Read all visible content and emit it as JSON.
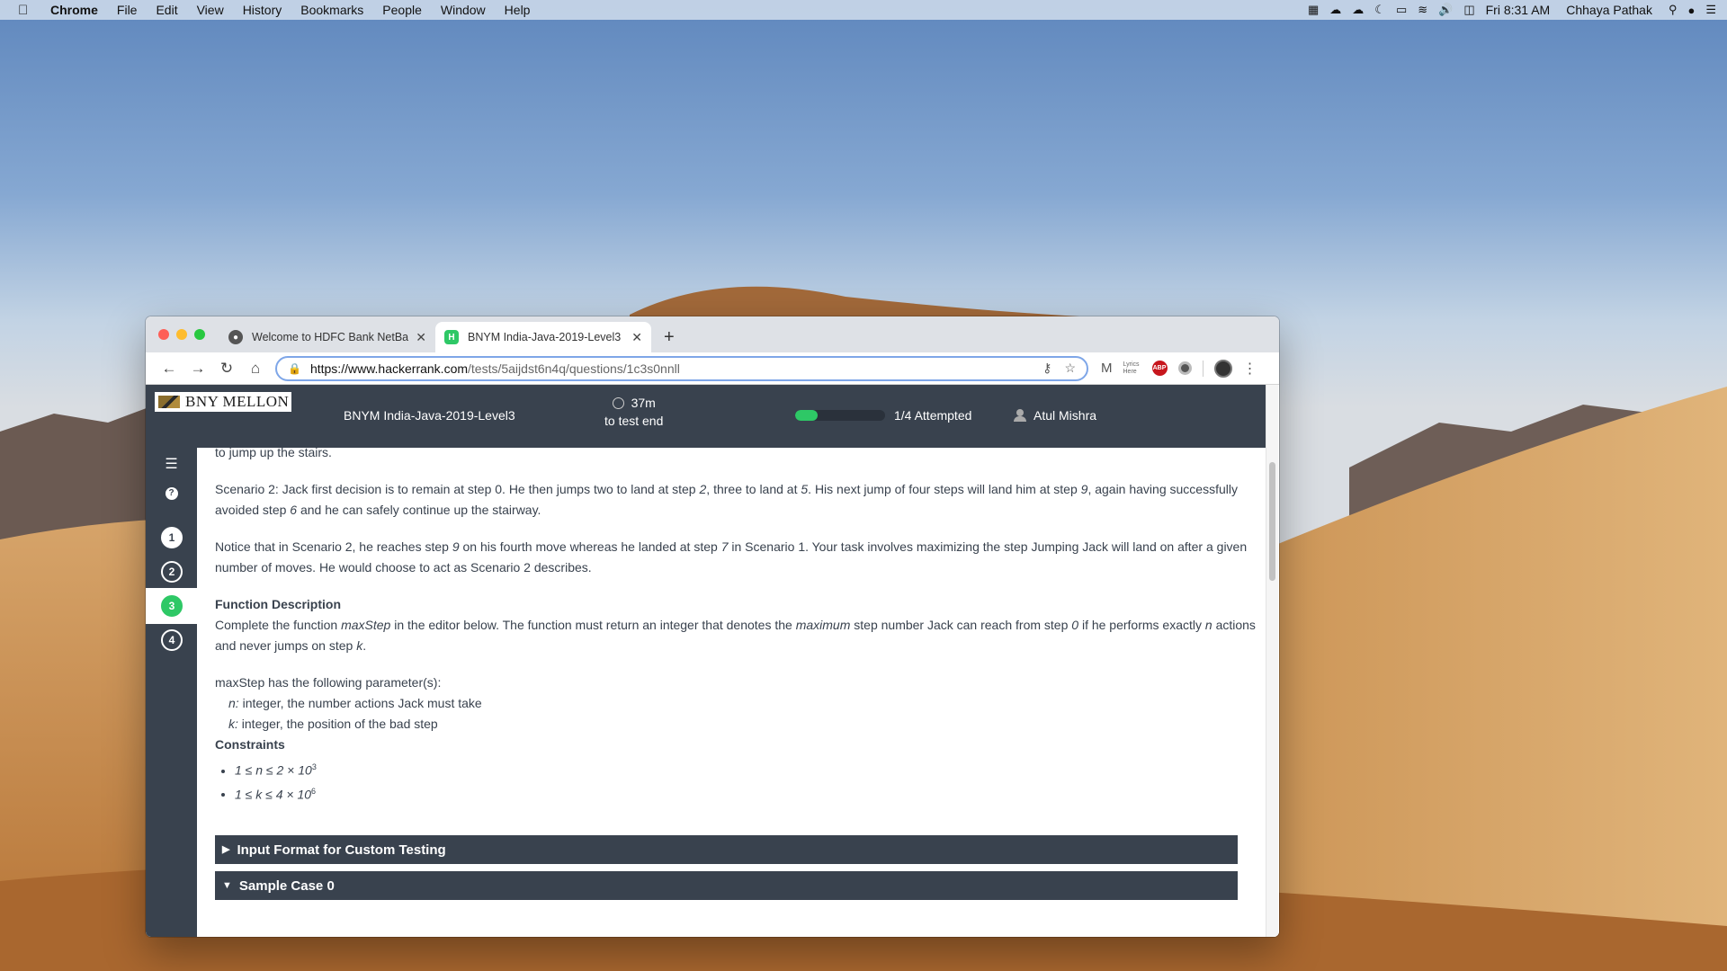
{
  "menubar": {
    "app": "Chrome",
    "menus": [
      "File",
      "Edit",
      "View",
      "History",
      "Bookmarks",
      "People",
      "Window",
      "Help"
    ],
    "clock": "Fri 8:31 AM",
    "user": "Chhaya Pathak"
  },
  "browser": {
    "tabs": [
      {
        "title": "Welcome to HDFC Bank NetBa"
      },
      {
        "title": "BNYM India-Java-2019-Level3"
      }
    ],
    "url_domain": "https://www.hackerrank.com",
    "url_path": "/tests/5aijdst6n4q/questions/1c3s0nnll",
    "extension_text": "Lyrics Here",
    "extension_abp": "ABP"
  },
  "header": {
    "logo": "BNY MELLON",
    "test_name": "BNYM India-Java-2019-Level3",
    "timer": "37m",
    "timer_sub": "to test end",
    "progress_fraction": 0.25,
    "progress_label": "1/4 Attempted",
    "user": "Atul Mishra"
  },
  "sidebar": {
    "questions": [
      "1",
      "2",
      "3",
      "4"
    ],
    "active_question": "3",
    "attempted_question": "1"
  },
  "content": {
    "line0": "to jump up the stairs.",
    "scenario2_a": "Scenario 2:  Jack first decision is to remain at step 0.  He then jumps two to land at step ",
    "scenario2_i1": "2",
    "scenario2_b": ", three to land at ",
    "scenario2_i2": "5",
    "scenario2_c": ".  His next jump of four steps will land him at step ",
    "scenario2_i3": "9",
    "scenario2_d": ", again having successfully avoided step ",
    "scenario2_i4": "6",
    "scenario2_e": " and he can safely continue up the stairway.",
    "notice_a": "Notice that in Scenario 2, he reaches step ",
    "notice_i1": "9",
    "notice_b": " on his fourth move whereas he landed at step ",
    "notice_i2": "7",
    "notice_c": " in Scenario 1. Your task involves maximizing the step Jumping Jack will land on after a given number of moves. He would choose to act as Scenario 2 describes.",
    "func_heading": "Function Description",
    "func_a": "Complete the function ",
    "func_i1": "maxStep",
    "func_b": " in the editor below. The function must return an integer that denotes the ",
    "func_i2": "maximum",
    "func_c": " step number Jack can reach from step ",
    "func_i3": "0",
    "func_d": " if he performs exactly ",
    "func_i4": "n",
    "func_e": " actions and never jumps on step ",
    "func_i5": "k",
    "func_f": ".",
    "params_intro": "maxStep has the following parameter(s):",
    "param_n_name": "n:",
    "param_n_desc": "  integer, the number actions Jack must take",
    "param_k_name": "k:",
    "param_k_desc": "  integer, the position of the bad step",
    "constraints_heading": "Constraints",
    "constraint1": "1 ≤ n ≤ 2 × 10",
    "constraint1_exp": "3",
    "constraint2": "1 ≤ k ≤ 4 × 10",
    "constraint2_exp": "6",
    "accordion1": "Input Format for Custom Testing",
    "accordion2": "Sample Case 0"
  }
}
